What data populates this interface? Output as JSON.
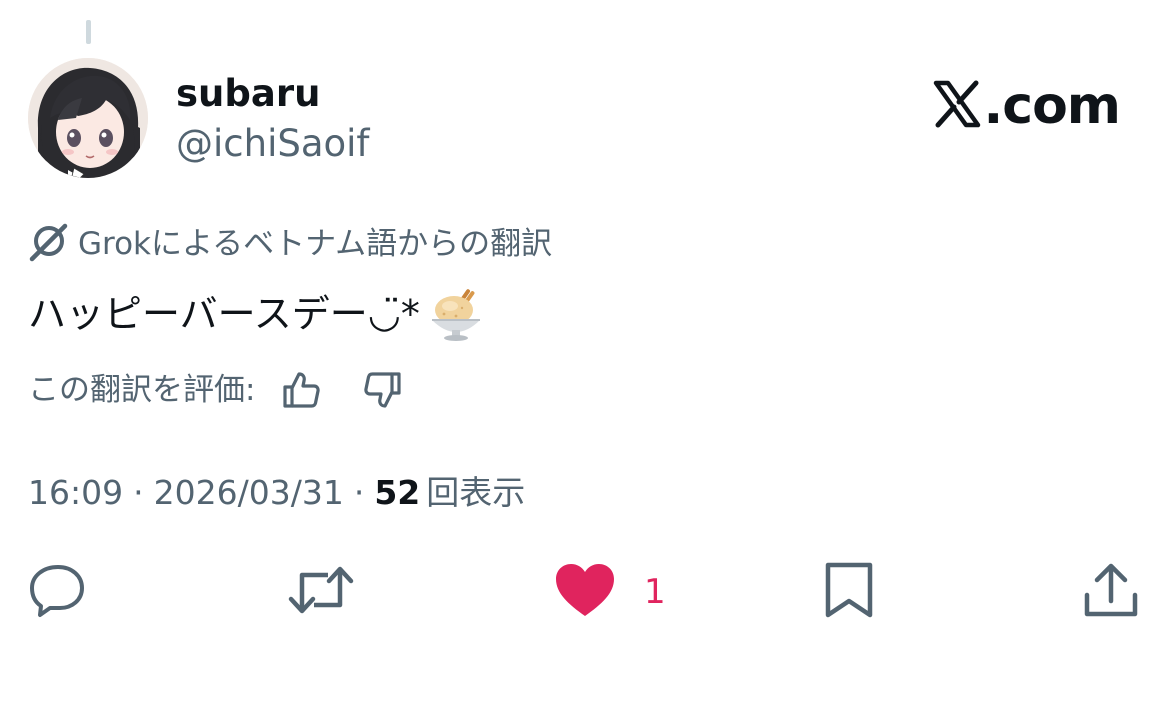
{
  "author": {
    "display_name": "subaru",
    "handle": "@ichiSaoif"
  },
  "brand": {
    "text": ".com",
    "icon": "x-logo-icon"
  },
  "translation": {
    "label": "Grokによるベトナム語からの翻訳",
    "icon": "grok-icon"
  },
  "tweet": {
    "text": "ハッピーバースデー◡̈*",
    "emoji": "ice-cream-emoji"
  },
  "rating": {
    "label": "この翻訳を評価:",
    "up_icon": "thumbs-up-icon",
    "down_icon": "thumbs-down-icon"
  },
  "meta": {
    "time": "16:09",
    "separator": "·",
    "date": "2026/03/31",
    "views_count": "52",
    "views_label": "回表示"
  },
  "actions": {
    "reply_icon": "reply-icon",
    "retweet_icon": "retweet-icon",
    "like_icon": "heart-icon",
    "like_count": "1",
    "bookmark_icon": "bookmark-icon",
    "share_icon": "share-icon"
  },
  "colors": {
    "text_primary": "#0f1419",
    "text_secondary": "#536471",
    "like": "#e0245e",
    "thread_line": "#cfd9de"
  }
}
